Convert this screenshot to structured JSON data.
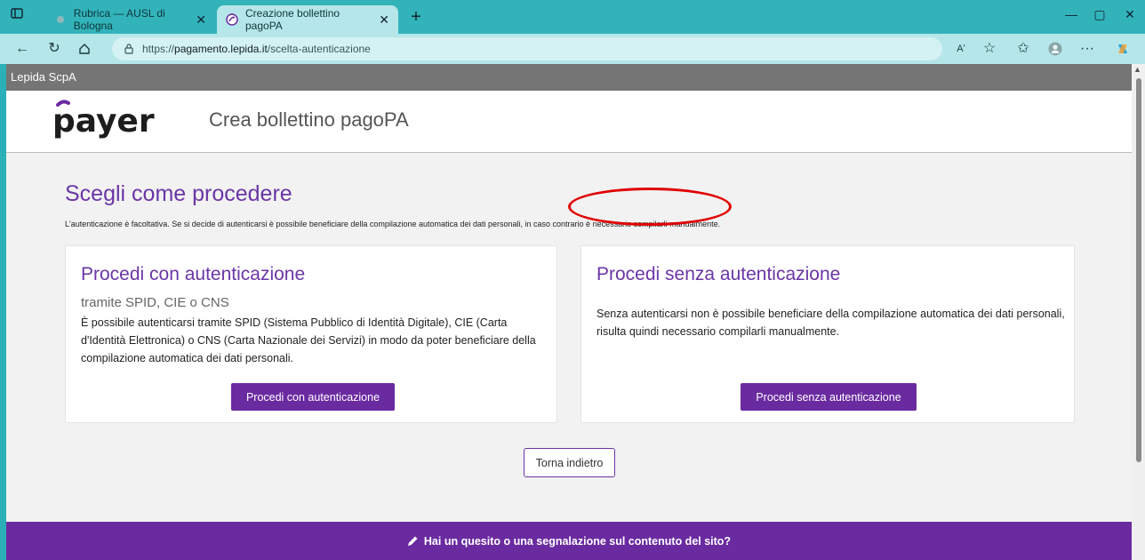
{
  "browser": {
    "tabs": [
      {
        "title": "Rubrica — AUSL di Bologna",
        "active": false
      },
      {
        "title": "Creazione bollettino pagoPA",
        "active": true
      }
    ],
    "url_prefix": "https://",
    "url_domain": "pagamento.lepida.it",
    "url_path": "/scelta-autenticazione",
    "read_aloud_label": "Aʹ"
  },
  "page": {
    "org_bar": "Lepida ScpA",
    "logo_text": "payer",
    "header_title": "Crea bollettino pagoPA",
    "heading": "Scegli come procedere",
    "intro": "L'autenticazione è facoltativa. Se si decide di autenticarsi è possibile beneficiare della compilazione automatica dei dati personali, in caso contrario è necessario compilarli manualmente.",
    "card_auth": {
      "title": "Procedi con autenticazione",
      "subtitle": "tramite SPID, CIE o CNS",
      "body": "È possibile autenticarsi tramite SPID (Sistema Pubblico di Identità Digitale), CIE (Carta d'Identità Elettronica) o CNS (Carta Nazionale dei Servizi) in modo da poter beneficiare della compilazione automatica dei dati personali.",
      "button": "Procedi con autenticazione"
    },
    "card_noauth": {
      "title": "Procedi senza autenticazione",
      "body": "Senza autenticarsi non è possibile beneficiare della compilazione automatica dei dati personali, risulta quindi necessario compilarli manualmente.",
      "button": "Procedi senza autenticazione"
    },
    "back_button": "Torna indietro",
    "footer": "Hai un quesito o una segnalazione sul contenuto del sito?"
  },
  "colors": {
    "accent": "#6a2aa0",
    "heading": "#6a36a6",
    "chrome": "#32b3ba",
    "annotation": "#e00000"
  }
}
